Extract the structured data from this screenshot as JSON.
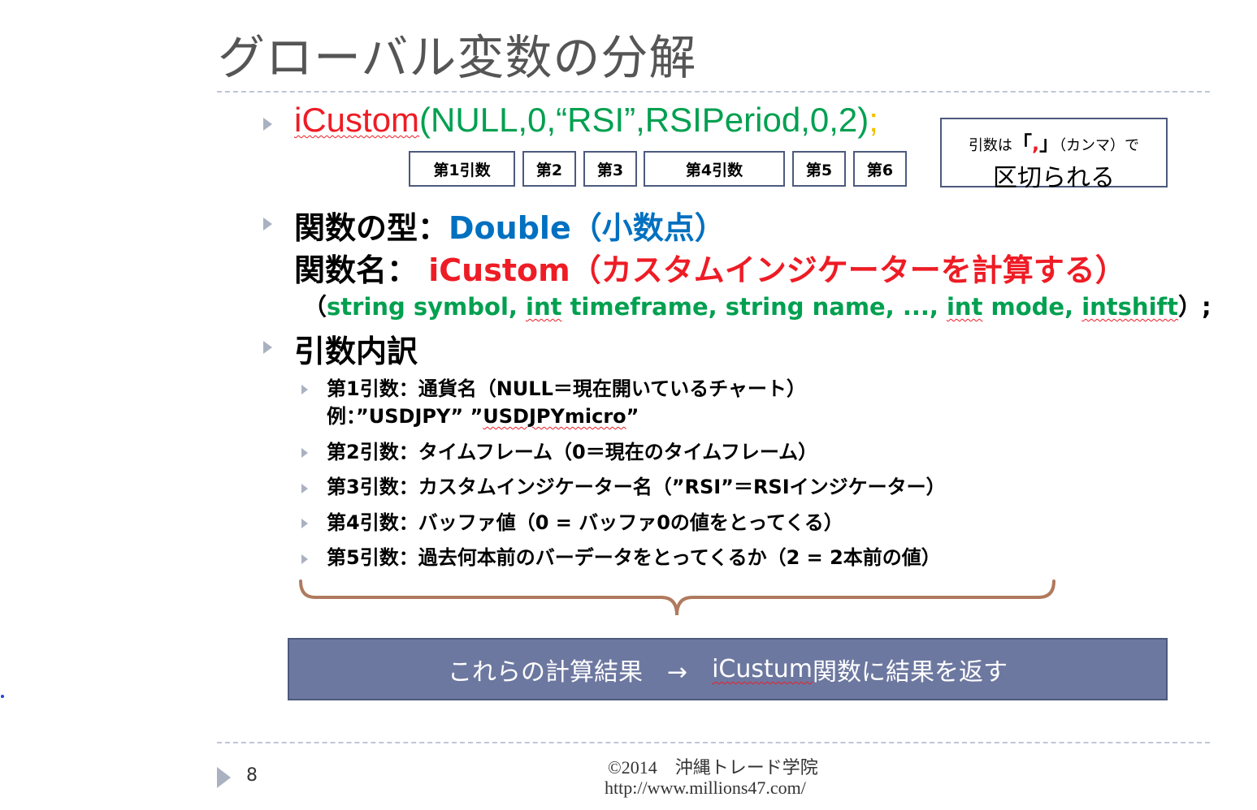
{
  "title": "グローバル変数の分解",
  "code": {
    "func": "iCustom",
    "open": "(",
    "args": "NULL,0,“RSI”,RSIPeriod,0,2",
    "close": ")",
    "tail": ";"
  },
  "arg_boxes": [
    "第1引数",
    "第2",
    "第3",
    "第4引数",
    "第5",
    "第6"
  ],
  "note": {
    "prefix": "引数は",
    "open_bracket": "「",
    "comma": ",",
    "close_bracket": "」",
    "suffix": "（カンマ）で",
    "line2": "区切られる"
  },
  "func_type": {
    "label": "関数の型：",
    "value": "Double（小数点）"
  },
  "func_name": {
    "label": "関数名：",
    "value": "iCustom（カスタムインジケーターを計算する）"
  },
  "signature": {
    "open": "（",
    "p1": "string symbol, ",
    "p2a": "int",
    "p2b": " timeframe, string name, ..., ",
    "p3a": "int",
    "p3b": " mode, ",
    "p4": "intshift",
    "close": "）;"
  },
  "args_heading": "引数内訳",
  "args_list": [
    {
      "line1": "第1引数：通貨名（NULL＝現在開いているチャート）",
      "line2_a": "例：”USDJPY” ”",
      "line2_b": "USDJPYmicro",
      "line2_c": "”"
    },
    {
      "line1": "第2引数：タイムフレーム（0＝現在のタイムフレーム）"
    },
    {
      "line1": "第3引数：カスタムインジケーター名（”RSI”＝RSIインジケーター）"
    },
    {
      "line1": "第4引数：バッファ値（0 = バッファ0の値をとってくる）"
    },
    {
      "line1": "第5引数：過去何本前のバーデータをとってくるか（2 = 2本前の値）"
    }
  ],
  "banner": {
    "left": "これらの計算結果　→　",
    "func": "iCustum",
    "right": "関数に結果を返す"
  },
  "footer": {
    "copyright": "©2014　沖縄トレード学院",
    "url": "http://www.millions47.com/",
    "page": "8"
  },
  "colors": {
    "red": "#ee1c25",
    "green": "#00a050",
    "blue": "#0070c0",
    "banner": "#6d78a0",
    "border": "#4d5a7e",
    "brace": "#b07a5e"
  }
}
